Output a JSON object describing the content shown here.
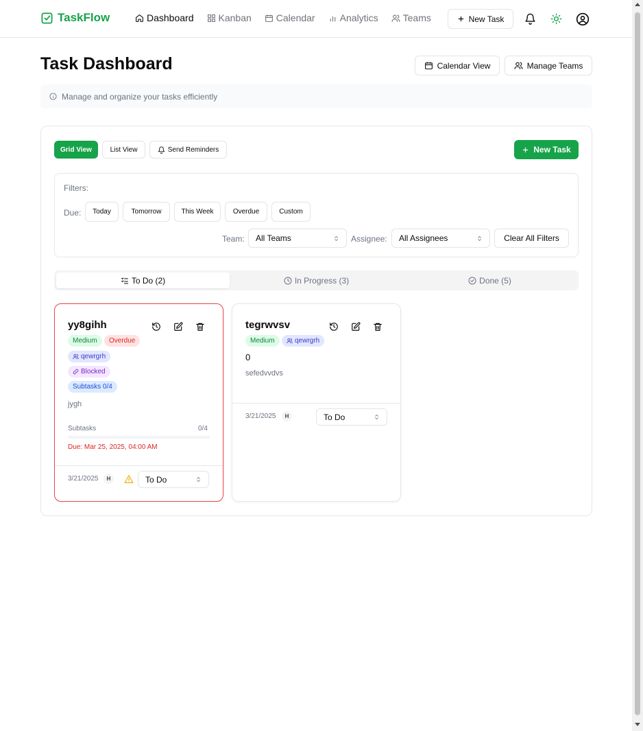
{
  "app": {
    "name": "TaskFlow"
  },
  "nav": {
    "links": [
      {
        "label": "Dashboard",
        "icon": "home-icon"
      },
      {
        "label": "Kanban",
        "icon": "grid-icon"
      },
      {
        "label": "Calendar",
        "icon": "calendar-icon"
      },
      {
        "label": "Analytics",
        "icon": "chart-icon"
      },
      {
        "label": "Teams",
        "icon": "users-icon"
      }
    ],
    "new_task": "New Task"
  },
  "header": {
    "title": "Task Dashboard",
    "calendar_view": "Calendar View",
    "manage_teams": "Manage Teams",
    "info": "Manage and organize your tasks efficiently"
  },
  "toolbar": {
    "grid_view": "Grid View",
    "list_view": "List View",
    "send_reminders": "Send Reminders",
    "new_task": "New Task"
  },
  "filters": {
    "title": "Filters:",
    "due_label": "Due:",
    "due_options": [
      "Today",
      "Tomorrow",
      "This Week",
      "Overdue",
      "Custom"
    ],
    "team_label": "Team:",
    "team_value": "All Teams",
    "assignee_label": "Assignee:",
    "assignee_value": "All Assignees",
    "clear": "Clear All Filters"
  },
  "tabs": {
    "todo": "To Do (2)",
    "in_progress": "In Progress (3)",
    "done": "Done (5)"
  },
  "tasks": [
    {
      "title": "yy8gihh",
      "priority": "Medium",
      "overdue": "Overdue",
      "team": "qewrgrh",
      "blocked": "Blocked",
      "subtasks_badge": "Subtasks 0/4",
      "description": "jygh",
      "subtasks_label": "Subtasks",
      "subtasks_count": "0/4",
      "subtasks_progress": 0,
      "due": "Due: Mar 25, 2025, 04:00 AM",
      "created": "3/21/2025",
      "assignee": "H",
      "status": "To Do"
    },
    {
      "title": "tegrwvsv",
      "priority": "Medium",
      "team": "qewrgrh",
      "number": "0",
      "description": "sefedvvdvs",
      "created": "3/21/2025",
      "assignee": "H",
      "status": "To Do"
    }
  ],
  "colors": {
    "accent": "#16a34a",
    "overdue": "#ef4444"
  }
}
